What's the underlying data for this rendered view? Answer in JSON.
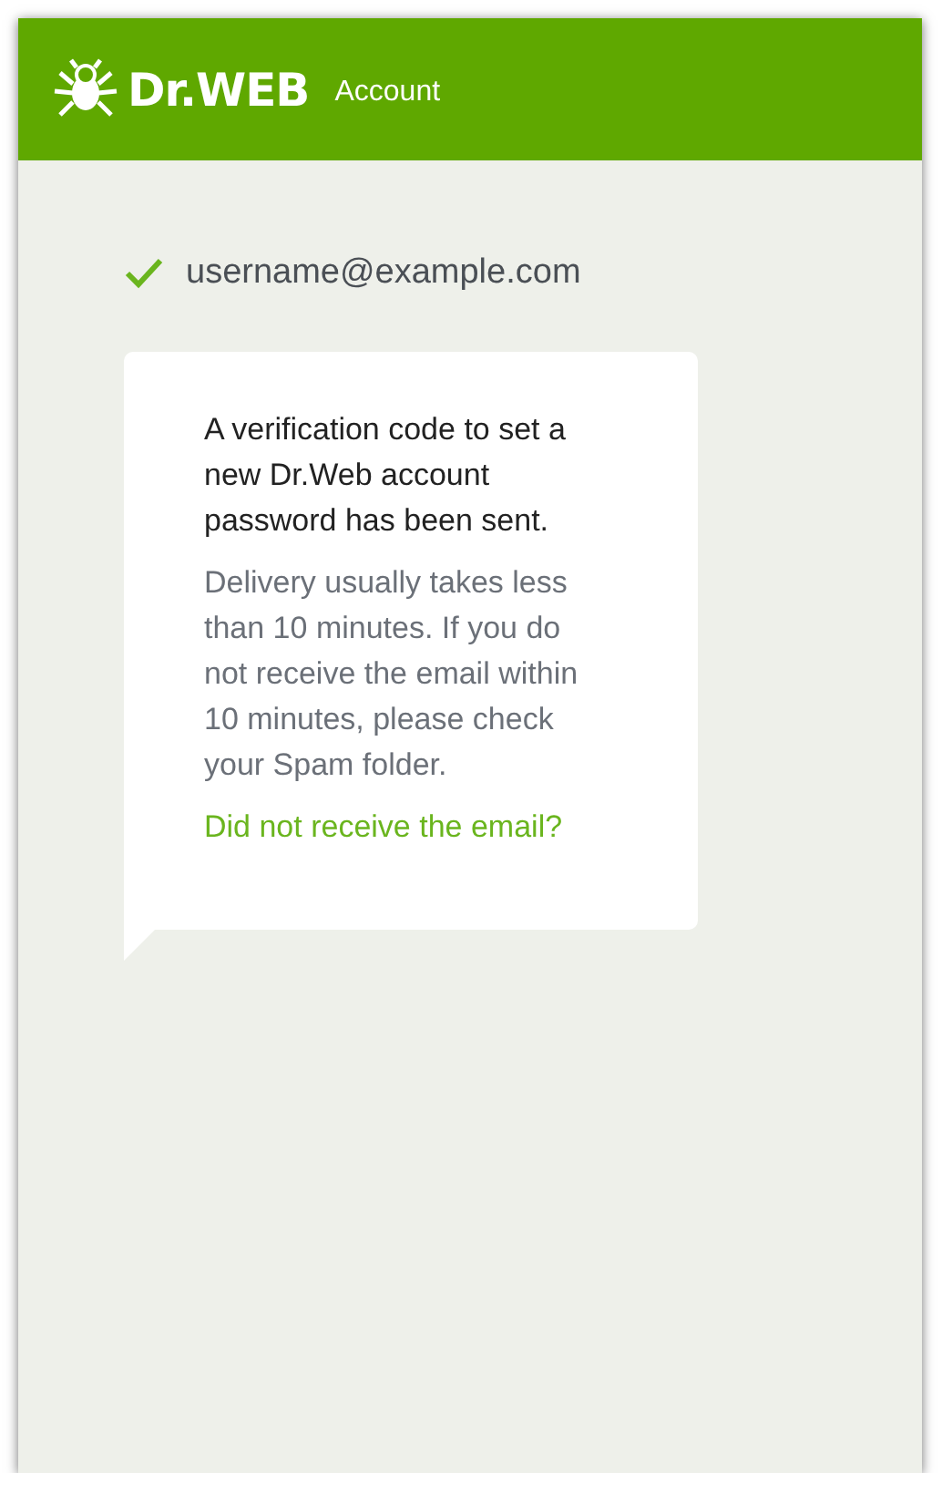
{
  "header": {
    "logo": "Dr.WEB",
    "title": "Account"
  },
  "account": {
    "email": "username@example.com",
    "verified": true
  },
  "message": {
    "heading": "A verification code to set a new Dr.Web account password has been sent.",
    "note": "Delivery usually takes less than 10 minutes. If you do not receive the email within 10 minutes, please check your Spam folder.",
    "link": "Did not receive the email?"
  }
}
